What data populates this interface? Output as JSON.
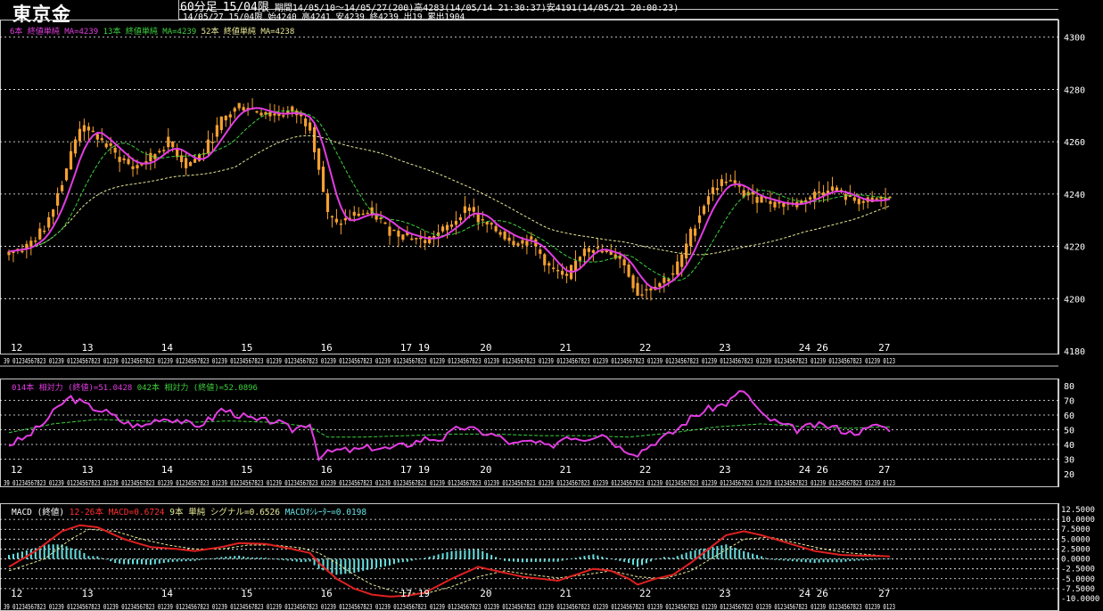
{
  "header": {
    "title": "東京金",
    "period_label": "60分足",
    "limit_label": "15/04限",
    "range_text": "期間14/05/10～14/05/27(200)高4283(14/05/14 21:30:37)安4191(14/05/21 20:00:23)",
    "last_bar_text": "14/05/27 15/04限 始4240 高4241 安4239 終4239 出19 累出1904"
  },
  "legends": {
    "price": [
      {
        "text": "6本 終値単純 MA=4239",
        "color": "#e23ce2"
      },
      {
        "text": "13本 終値単純 MA=4239",
        "color": "#3cd23c"
      },
      {
        "text": "52本 終値単純 MA=4238",
        "color": "#e8e896"
      }
    ],
    "rsi": [
      {
        "text": "014本 相対力 (終値)=51.0428",
        "color": "#e23ce2"
      },
      {
        "text": "042本 相対力 (終値)=52.0896",
        "color": "#3cd23c"
      }
    ],
    "macd": [
      {
        "text": "MACD (終値)",
        "color": "#ffffff"
      },
      {
        "text": "12-26本 MACD=0.6724",
        "color": "#ff3030"
      },
      {
        "text": "9本 単純 シグナル=0.6526",
        "color": "#e8e896"
      },
      {
        "text": "MACDｵｼﾚｰﾀｰ=0.0198",
        "color": "#66e0e0"
      }
    ]
  },
  "colors": {
    "candle": "#f5a030",
    "ma6": "#e23ce2",
    "ma13": "#3cd23c",
    "ma52": "#e8e896",
    "macd": "#e02020",
    "signal": "#e8e896",
    "osc": "#66e0e0",
    "grid": "#ffffff"
  },
  "day_labels": [
    {
      "label": "12",
      "bar": 0
    },
    {
      "label": "13",
      "bar": 16
    },
    {
      "label": "14",
      "bar": 34
    },
    {
      "label": "15",
      "bar": 52
    },
    {
      "label": "16",
      "bar": 70
    },
    {
      "label": "17",
      "bar": 88
    },
    {
      "label": "19",
      "bar": 92
    },
    {
      "label": "20",
      "bar": 106
    },
    {
      "label": "21",
      "bar": 124
    },
    {
      "label": "22",
      "bar": 142
    },
    {
      "label": "23",
      "bar": 160
    },
    {
      "label": "24",
      "bar": 178
    },
    {
      "label": "26",
      "bar": 182
    },
    {
      "label": "27",
      "bar": 196
    }
  ],
  "hour_strip_text": "39 01234567823 01239 01234567823 01239 01234567823 01239 01234567823 01239 01234567823 01239 01234567823 01239 01234567823 01239 01234567823 01239 01234567823 01239 01234567823 01239 01234567823 01239 01234567823 01239 01234567823 01239 01234567823 01239 01234567823 01239 01234567823 01239 0123",
  "chart_data": [
    {
      "type": "candlestick",
      "name": "price",
      "bars": 200,
      "y_ticks": [
        4180,
        4200,
        4220,
        4240,
        4260,
        4280,
        4300
      ],
      "ylim": [
        4180,
        4304
      ],
      "grid": "dashed",
      "close_anchors": [
        [
          0,
          4218
        ],
        [
          4,
          4220
        ],
        [
          8,
          4227
        ],
        [
          12,
          4245
        ],
        [
          16,
          4266
        ],
        [
          20,
          4262
        ],
        [
          24,
          4255
        ],
        [
          28,
          4250
        ],
        [
          32,
          4254
        ],
        [
          36,
          4260
        ],
        [
          40,
          4251
        ],
        [
          44,
          4256
        ],
        [
          48,
          4268
        ],
        [
          52,
          4274
        ],
        [
          56,
          4272
        ],
        [
          60,
          4270
        ],
        [
          64,
          4272
        ],
        [
          68,
          4266
        ],
        [
          70,
          4250
        ],
        [
          72,
          4232
        ],
        [
          74,
          4228
        ],
        [
          78,
          4232
        ],
        [
          82,
          4233
        ],
        [
          86,
          4226
        ],
        [
          90,
          4224
        ],
        [
          94,
          4222
        ],
        [
          98,
          4226
        ],
        [
          102,
          4232
        ],
        [
          104,
          4236
        ],
        [
          106,
          4230
        ],
        [
          110,
          4226
        ],
        [
          114,
          4222
        ],
        [
          118,
          4222
        ],
        [
          122,
          4212
        ],
        [
          126,
          4208
        ],
        [
          130,
          4220
        ],
        [
          134,
          4218
        ],
        [
          138,
          4216
        ],
        [
          142,
          4202
        ],
        [
          146,
          4205
        ],
        [
          150,
          4210
        ],
        [
          152,
          4216
        ],
        [
          154,
          4225
        ],
        [
          158,
          4240
        ],
        [
          162,
          4246
        ],
        [
          166,
          4240
        ],
        [
          170,
          4238
        ],
        [
          174,
          4236
        ],
        [
          178,
          4236
        ],
        [
          182,
          4240
        ],
        [
          186,
          4242
        ],
        [
          190,
          4238
        ],
        [
          194,
          4237
        ],
        [
          199,
          4239
        ]
      ],
      "summary": {
        "high": 4283,
        "low": 4191,
        "last_close": 4239,
        "ma6": 4239,
        "ma13": 4239,
        "ma52": 4238
      }
    },
    {
      "type": "line",
      "name": "rsi",
      "y_ticks": [
        20,
        30,
        40,
        50,
        60,
        70,
        80
      ],
      "ylim": [
        20,
        80
      ],
      "series": [
        {
          "name": "014本 相対力",
          "anchors": [
            [
              0,
              40
            ],
            [
              4,
              45
            ],
            [
              8,
              55
            ],
            [
              12,
              68
            ],
            [
              14,
              72
            ],
            [
              18,
              66
            ],
            [
              22,
              62
            ],
            [
              26,
              55
            ],
            [
              30,
              52
            ],
            [
              34,
              58
            ],
            [
              38,
              57
            ],
            [
              42,
              52
            ],
            [
              46,
              58
            ],
            [
              48,
              64
            ],
            [
              52,
              60
            ],
            [
              56,
              56
            ],
            [
              60,
              56
            ],
            [
              64,
              50
            ],
            [
              68,
              55
            ],
            [
              70,
              32
            ],
            [
              74,
              36
            ],
            [
              78,
              36
            ],
            [
              82,
              38
            ],
            [
              86,
              37
            ],
            [
              90,
              40
            ],
            [
              94,
              44
            ],
            [
              98,
              44
            ],
            [
              102,
              52
            ],
            [
              106,
              49
            ],
            [
              110,
              46
            ],
            [
              114,
              40
            ],
            [
              118,
              42
            ],
            [
              122,
              38
            ],
            [
              126,
              46
            ],
            [
              130,
              44
            ],
            [
              134,
              48
            ],
            [
              138,
              38
            ],
            [
              142,
              34
            ],
            [
              146,
              42
            ],
            [
              150,
              48
            ],
            [
              154,
              58
            ],
            [
              158,
              64
            ],
            [
              162,
              68
            ],
            [
              166,
              77
            ],
            [
              170,
              60
            ],
            [
              174,
              54
            ],
            [
              178,
              50
            ],
            [
              182,
              53
            ],
            [
              186,
              52
            ],
            [
              190,
              48
            ],
            [
              194,
              50
            ],
            [
              196,
              54
            ],
            [
              198,
              51
            ]
          ]
        },
        {
          "name": "042本 相対力",
          "anchors": [
            [
              0,
              48
            ],
            [
              10,
              54
            ],
            [
              20,
              57
            ],
            [
              30,
              56
            ],
            [
              40,
              55
            ],
            [
              50,
              56
            ],
            [
              60,
              55
            ],
            [
              68,
              52
            ],
            [
              72,
              45
            ],
            [
              80,
              45
            ],
            [
              90,
              46
            ],
            [
              100,
              47
            ],
            [
              110,
              47
            ],
            [
              120,
              46
            ],
            [
              130,
              46
            ],
            [
              140,
              45
            ],
            [
              150,
              48
            ],
            [
              160,
              52
            ],
            [
              170,
              54
            ],
            [
              180,
              52
            ],
            [
              190,
              51
            ],
            [
              198,
              52
            ]
          ]
        }
      ],
      "summary": {
        "rsi14": 51.0428,
        "rsi42": 52.0896
      }
    },
    {
      "type": "line",
      "name": "macd",
      "y_ticks": [
        -10,
        -7.5,
        -5,
        -2.5,
        0,
        2.5,
        5,
        7.5,
        10,
        12.5
      ],
      "y_tick_labels": [
        "-10.0000",
        "-7.5000",
        "-5.0000",
        "-2.5000",
        "0.0000",
        "2.5000",
        "5.0000",
        "7.5000",
        "10.0000",
        "12.5000"
      ],
      "ylim": [
        -10,
        12.5
      ],
      "series": [
        {
          "name": "12-26本 MACD",
          "anchors": [
            [
              0,
              -2
            ],
            [
              6,
              2
            ],
            [
              12,
              7
            ],
            [
              16,
              8.5
            ],
            [
              20,
              8
            ],
            [
              26,
              5
            ],
            [
              32,
              3
            ],
            [
              38,
              2.5
            ],
            [
              42,
              2
            ],
            [
              48,
              3
            ],
            [
              52,
              4
            ],
            [
              58,
              3.8
            ],
            [
              64,
              2.5
            ],
            [
              68,
              1.5
            ],
            [
              70,
              -1
            ],
            [
              74,
              -5
            ],
            [
              78,
              -7.5
            ],
            [
              82,
              -9
            ],
            [
              86,
              -9.5
            ],
            [
              90,
              -9.3
            ],
            [
              94,
              -8.5
            ],
            [
              100,
              -5
            ],
            [
              106,
              -2
            ],
            [
              110,
              -3
            ],
            [
              116,
              -4.5
            ],
            [
              120,
              -5
            ],
            [
              124,
              -5.5
            ],
            [
              128,
              -4
            ],
            [
              132,
              -2.5
            ],
            [
              136,
              -3
            ],
            [
              140,
              -5
            ],
            [
              142,
              -6.5
            ],
            [
              146,
              -5
            ],
            [
              150,
              -4
            ],
            [
              154,
              -1
            ],
            [
              158,
              2.5
            ],
            [
              162,
              6
            ],
            [
              166,
              7
            ],
            [
              170,
              6
            ],
            [
              176,
              4
            ],
            [
              182,
              2
            ],
            [
              188,
              1
            ],
            [
              194,
              0.8
            ],
            [
              199,
              0.67
            ]
          ]
        },
        {
          "name": "9本 単純 シグナル",
          "anchors": [
            [
              0,
              -3
            ],
            [
              8,
              0
            ],
            [
              14,
              5
            ],
            [
              18,
              7.5
            ],
            [
              24,
              7
            ],
            [
              30,
              5
            ],
            [
              36,
              3.5
            ],
            [
              42,
              2.5
            ],
            [
              48,
              2.5
            ],
            [
              54,
              3.5
            ],
            [
              60,
              3.5
            ],
            [
              66,
              2.8
            ],
            [
              70,
              1.5
            ],
            [
              74,
              -1
            ],
            [
              78,
              -4
            ],
            [
              82,
              -6.5
            ],
            [
              88,
              -8.5
            ],
            [
              94,
              -8.8
            ],
            [
              100,
              -7
            ],
            [
              106,
              -4.5
            ],
            [
              112,
              -3
            ],
            [
              118,
              -4
            ],
            [
              124,
              -4.8
            ],
            [
              130,
              -4
            ],
            [
              136,
              -3
            ],
            [
              142,
              -4.5
            ],
            [
              148,
              -5
            ],
            [
              154,
              -3
            ],
            [
              160,
              1
            ],
            [
              166,
              5
            ],
            [
              172,
              5.5
            ],
            [
              178,
              4
            ],
            [
              184,
              2.5
            ],
            [
              190,
              1.5
            ],
            [
              199,
              0.65
            ]
          ]
        }
      ],
      "summary": {
        "macd": 0.6724,
        "signal": 0.6526,
        "oscillator": 0.0198
      }
    }
  ]
}
